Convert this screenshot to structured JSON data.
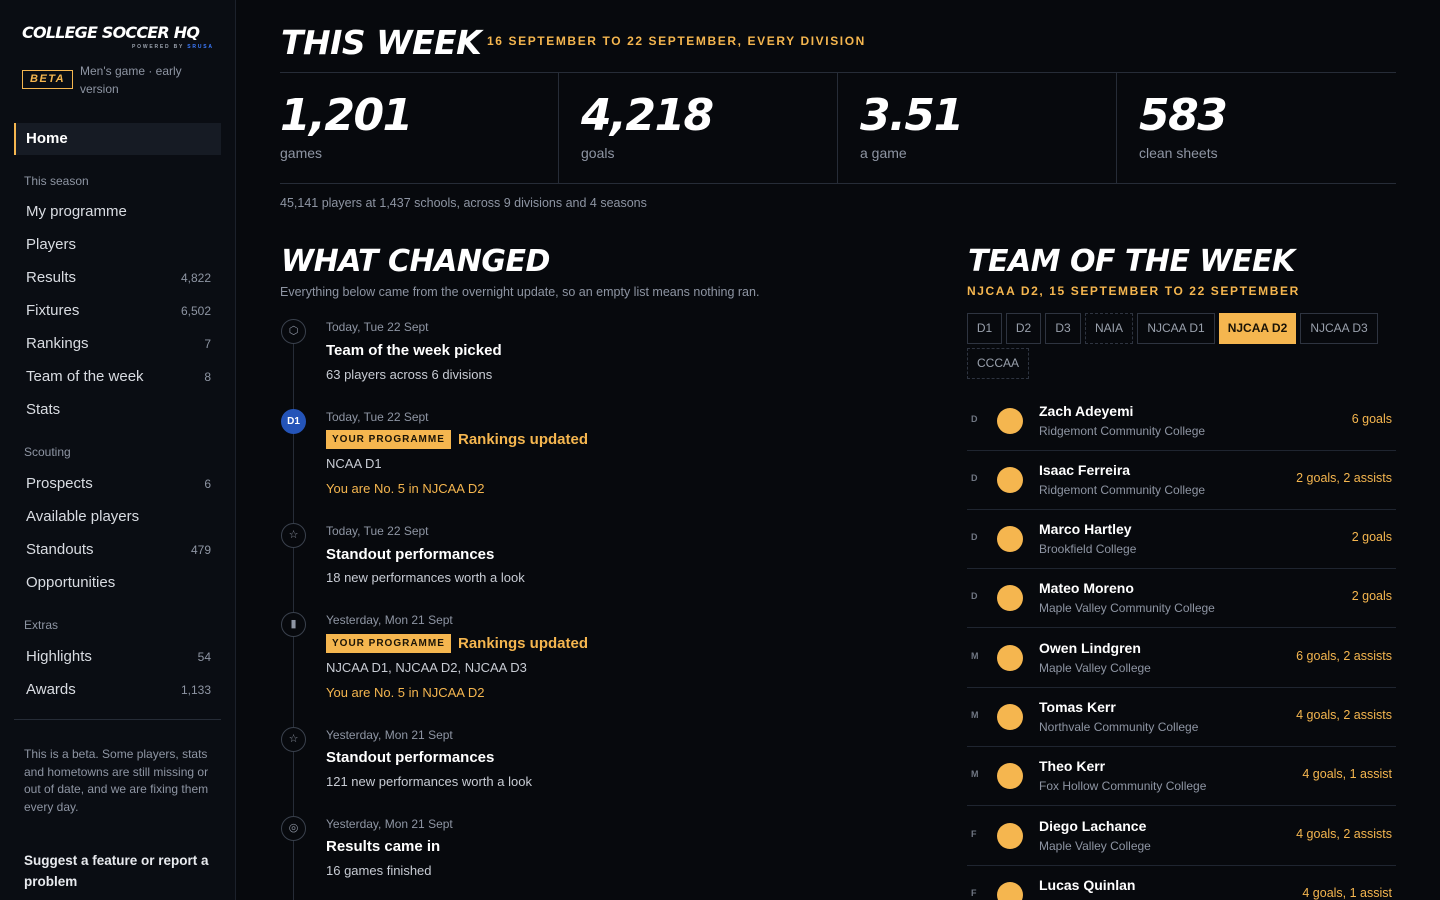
{
  "brand": {
    "logo_main": "COLLEGE SOCCER HQ",
    "logo_powered": "POWERED BY",
    "logo_powered_brand": "SRUSA",
    "beta": "BETA",
    "beta_text": "Men's game · early version"
  },
  "nav": {
    "home": "Home",
    "sections": [
      {
        "label": "This season",
        "items": [
          {
            "label": "My programme",
            "count": ""
          },
          {
            "label": "Players",
            "count": ""
          },
          {
            "label": "Results",
            "count": "4,822"
          },
          {
            "label": "Fixtures",
            "count": "6,502"
          },
          {
            "label": "Rankings",
            "count": "7"
          },
          {
            "label": "Team of the week",
            "count": "8"
          },
          {
            "label": "Stats",
            "count": ""
          }
        ]
      },
      {
        "label": "Scouting",
        "items": [
          {
            "label": "Prospects",
            "count": "6"
          },
          {
            "label": "Available players",
            "count": ""
          },
          {
            "label": "Standouts",
            "count": "479"
          },
          {
            "label": "Opportunities",
            "count": ""
          }
        ]
      },
      {
        "label": "Extras",
        "items": [
          {
            "label": "Highlights",
            "count": "54"
          },
          {
            "label": "Awards",
            "count": "1,133"
          }
        ]
      }
    ],
    "note": "This is a beta. Some players, stats and hometowns are still missing or out of date, and we are fixing them every day.",
    "feedback": "Suggest a feature or report a problem"
  },
  "week": {
    "title": "THIS WEEK",
    "subtitle": "16 SEPTEMBER TO 22 SEPTEMBER, EVERY DIVISION",
    "stats": [
      {
        "value": "1,201",
        "label": "games"
      },
      {
        "value": "4,218",
        "label": "goals"
      },
      {
        "value": "3.51",
        "label": "a game"
      },
      {
        "value": "583",
        "label": "clean sheets"
      }
    ],
    "note": "45,141 players at 1,437 schools, across 9 divisions and 4 seasons"
  },
  "changed": {
    "title": "WHAT CHANGED",
    "subtitle": "Everything below came from the overnight update, so an empty list means nothing ran.",
    "events": [
      {
        "icon": "shield-icon",
        "glyph": "⬡",
        "date": "Today, Tue 22 Sept",
        "title": "Team of the week picked",
        "badge": "",
        "lines": [
          "63 players across 6 divisions"
        ],
        "accent_line": ""
      },
      {
        "icon": "division-d1-icon",
        "glyph": "D1",
        "date": "Today, Tue 22 Sept",
        "title": "Rankings updated",
        "badge": "YOUR PROGRAMME",
        "lines": [
          "NCAA D1"
        ],
        "accent_line": "You are No. 5 in NJCAA D2"
      },
      {
        "icon": "star-icon",
        "glyph": "☆",
        "date": "Today, Tue 22 Sept",
        "title": "Standout performances",
        "badge": "",
        "lines": [
          "18 new performances worth a look"
        ],
        "accent_line": ""
      },
      {
        "icon": "bar-chart-icon",
        "glyph": "▮",
        "date": "Yesterday, Mon 21 Sept",
        "title": "Rankings updated",
        "badge": "YOUR PROGRAMME",
        "lines": [
          "NJCAA D1, NJCAA D2, NJCAA D3"
        ],
        "accent_line": "You are No. 5 in NJCAA D2"
      },
      {
        "icon": "star-icon",
        "glyph": "☆",
        "date": "Yesterday, Mon 21 Sept",
        "title": "Standout performances",
        "badge": "",
        "lines": [
          "121 new performances worth a look"
        ],
        "accent_line": ""
      },
      {
        "icon": "target-icon",
        "glyph": "◎",
        "date": "Yesterday, Mon 21 Sept",
        "title": "Results came in",
        "badge": "",
        "lines": [
          "16 games finished"
        ],
        "accent_line": ""
      }
    ]
  },
  "totw": {
    "title": "TEAM OF THE WEEK",
    "subtitle": "NJCAA D2, 15 SEPTEMBER TO 22 SEPTEMBER",
    "divisions": [
      {
        "label": "D1",
        "state": "normal"
      },
      {
        "label": "D2",
        "state": "normal"
      },
      {
        "label": "D3",
        "state": "normal"
      },
      {
        "label": "NAIA",
        "state": "dashed"
      },
      {
        "label": "NJCAA D1",
        "state": "normal"
      },
      {
        "label": "NJCAA D2",
        "state": "active"
      },
      {
        "label": "NJCAA D3",
        "state": "normal"
      },
      {
        "label": "CCCAA",
        "state": "dashed"
      }
    ],
    "players": [
      {
        "pos": "D",
        "name": "Zach Adeyemi",
        "school": "Ridgemont Community College",
        "stat": "6 goals"
      },
      {
        "pos": "D",
        "name": "Isaac Ferreira",
        "school": "Ridgemont Community College",
        "stat": "2 goals, 2 assists"
      },
      {
        "pos": "D",
        "name": "Marco Hartley",
        "school": "Brookfield College",
        "stat": "2 goals"
      },
      {
        "pos": "D",
        "name": "Mateo Moreno",
        "school": "Maple Valley Community College",
        "stat": "2 goals"
      },
      {
        "pos": "M",
        "name": "Owen Lindgren",
        "school": "Maple Valley College",
        "stat": "6 goals, 2 assists"
      },
      {
        "pos": "M",
        "name": "Tomas Kerr",
        "school": "Northvale Community College",
        "stat": "4 goals, 2 assists"
      },
      {
        "pos": "M",
        "name": "Theo Kerr",
        "school": "Fox Hollow Community College",
        "stat": "4 goals, 1 assist"
      },
      {
        "pos": "F",
        "name": "Diego Lachance",
        "school": "Maple Valley College",
        "stat": "4 goals, 2 assists"
      },
      {
        "pos": "F",
        "name": "Lucas Quinlan",
        "school": "",
        "stat": "4 goals, 1 assist"
      }
    ]
  },
  "colors": {
    "accent": "#f5b64f",
    "background": "#07090d",
    "division_blue": "#2454b8"
  }
}
